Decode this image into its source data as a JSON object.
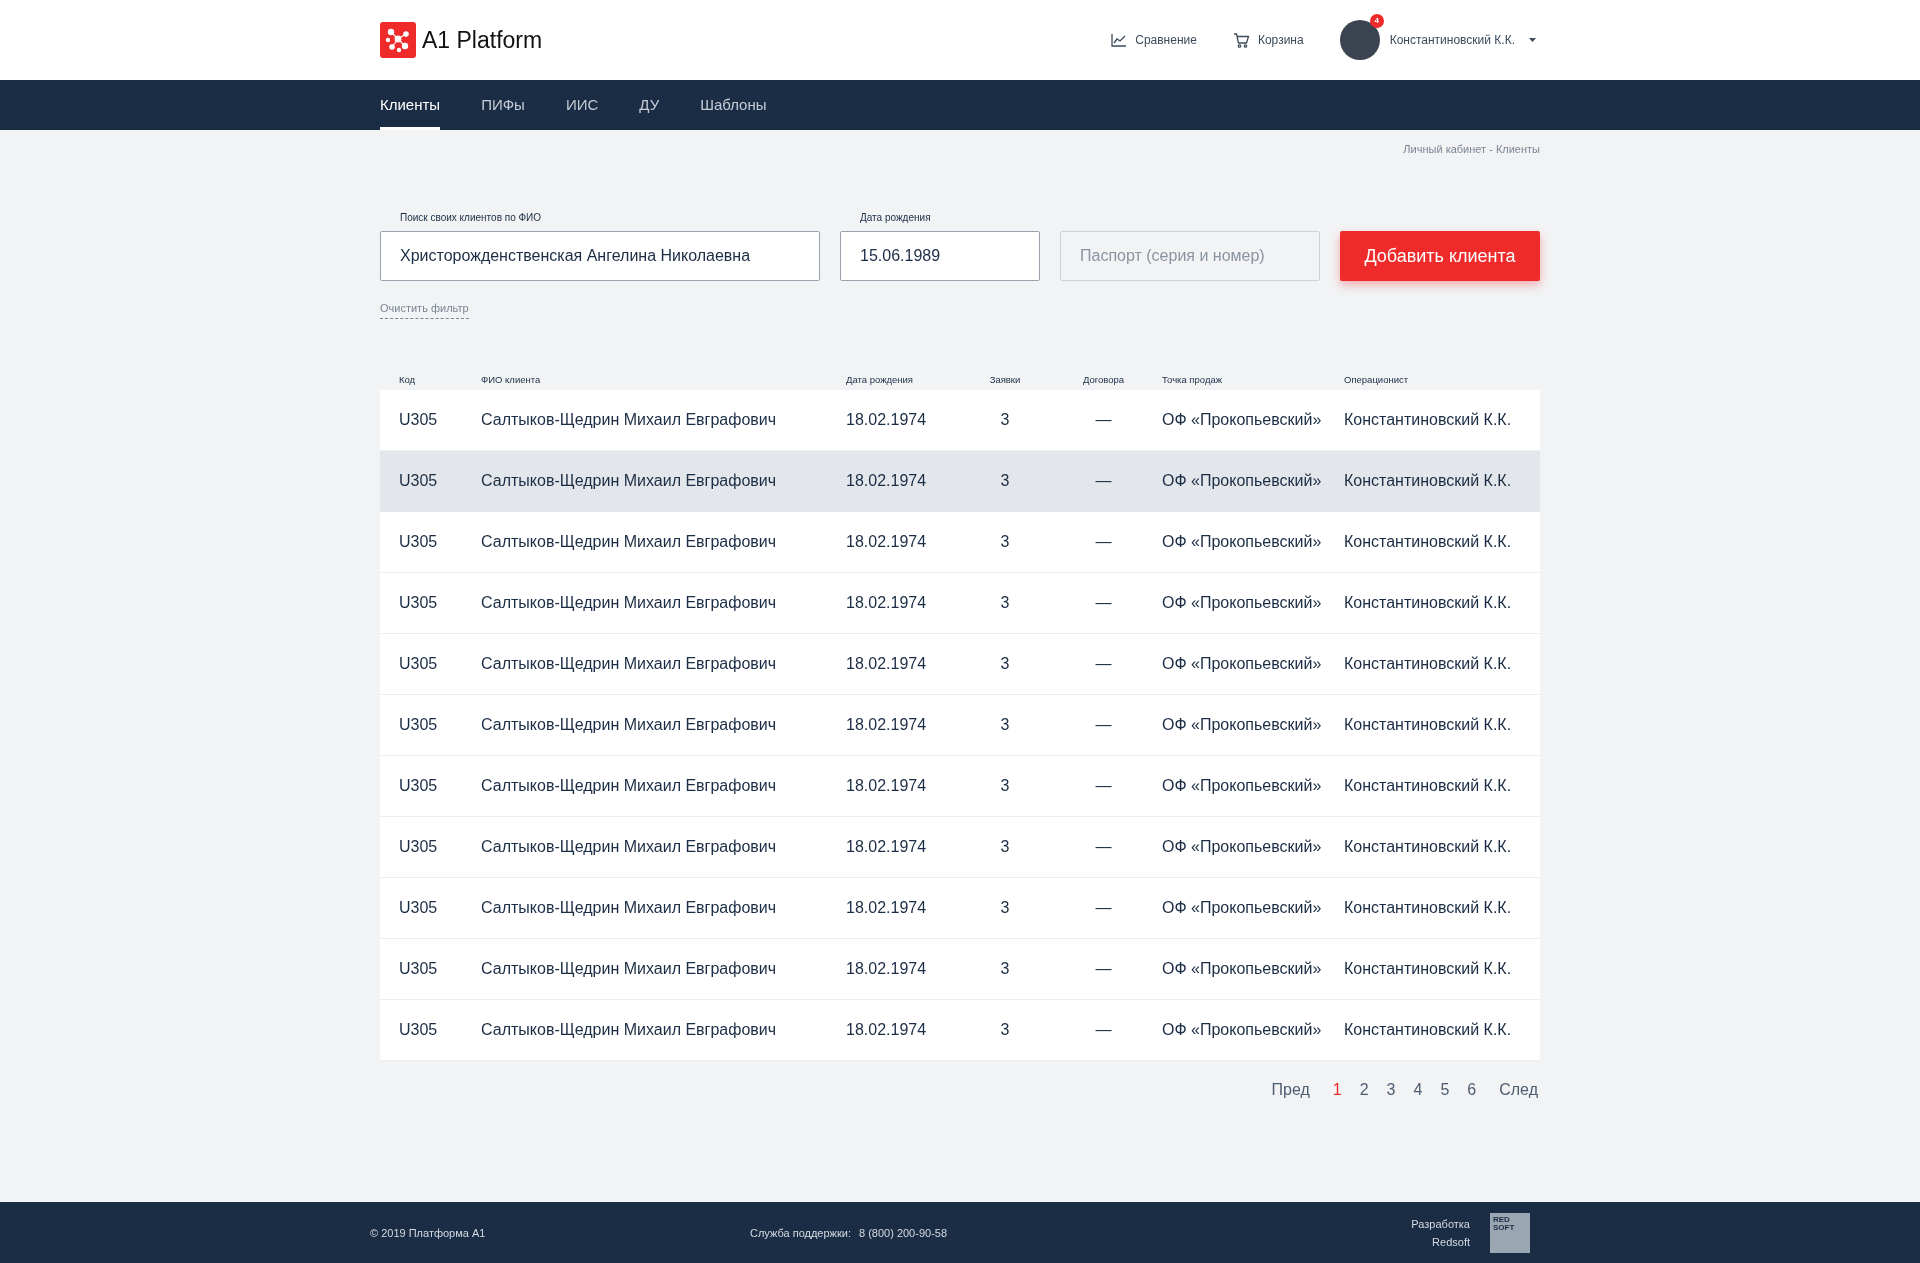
{
  "header": {
    "logo_text": "A1 Platform",
    "links": [
      {
        "kind": "chart",
        "label": "Сравнение"
      },
      {
        "kind": "cart",
        "label": "Корзина"
      }
    ],
    "user": {
      "name": "Константиновский К.К.",
      "badge": "4"
    }
  },
  "nav": [
    {
      "label": "Клиенты",
      "selected": true
    },
    {
      "label": "ПИФы",
      "selected": false
    },
    {
      "label": "ИИС",
      "selected": false
    },
    {
      "label": "ДУ",
      "selected": false
    },
    {
      "label": "Шаблоны",
      "selected": false
    }
  ],
  "breadcrumb": "Личный кабинет - Клиенты",
  "filters": {
    "name_field": {
      "label": "Поиск своих клиентов по ФИО",
      "value": "Христорожденственская Ангелина Николаевна"
    },
    "birth_field": {
      "label": "Дата рождения",
      "value": "15.06.1989"
    },
    "passport_field": {
      "placeholder": "Паспорт (серия и номер)"
    },
    "add_button": "Добавить клиента",
    "clear_link": "Очистить фильтр"
  },
  "table": {
    "columns": [
      "Код",
      "ФИО клиента",
      "Дата рождения",
      "Заявки",
      "Договора",
      "Точка продаж",
      "Операционист"
    ],
    "rows": [
      {
        "cells": [
          "U305",
          "Салтыков-Щедрин Михаил Евграфович",
          "18.02.1974",
          "3",
          "—",
          "ОФ «Прокопьевский»",
          "Константиновский К.К."
        ],
        "highlighted": false
      },
      {
        "cells": [
          "U305",
          "Салтыков-Щедрин Михаил Евграфович",
          "18.02.1974",
          "3",
          "—",
          "ОФ «Прокопьевский»",
          "Константиновский К.К."
        ],
        "highlighted": true
      },
      {
        "cells": [
          "U305",
          "Салтыков-Щедрин Михаил Евграфович",
          "18.02.1974",
          "3",
          "—",
          "ОФ «Прокопьевский»",
          "Константиновский К.К."
        ],
        "highlighted": false
      },
      {
        "cells": [
          "U305",
          "Салтыков-Щедрин Михаил Евграфович",
          "18.02.1974",
          "3",
          "—",
          "ОФ «Прокопьевский»",
          "Константиновский К.К."
        ],
        "highlighted": false
      },
      {
        "cells": [
          "U305",
          "Салтыков-Щедрин Михаил Евграфович",
          "18.02.1974",
          "3",
          "—",
          "ОФ «Прокопьевский»",
          "Константиновский К.К."
        ],
        "highlighted": false
      },
      {
        "cells": [
          "U305",
          "Салтыков-Щедрин Михаил Евграфович",
          "18.02.1974",
          "3",
          "—",
          "ОФ «Прокопьевский»",
          "Константиновский К.К."
        ],
        "highlighted": false
      },
      {
        "cells": [
          "U305",
          "Салтыков-Щедрин Михаил Евграфович",
          "18.02.1974",
          "3",
          "—",
          "ОФ «Прокопьевский»",
          "Константиновский К.К."
        ],
        "highlighted": false
      },
      {
        "cells": [
          "U305",
          "Салтыков-Щедрин Михаил Евграфович",
          "18.02.1974",
          "3",
          "—",
          "ОФ «Прокопьевский»",
          "Константиновский К.К."
        ],
        "highlighted": false
      },
      {
        "cells": [
          "U305",
          "Салтыков-Щедрин Михаил Евграфович",
          "18.02.1974",
          "3",
          "—",
          "ОФ «Прокопьевский»",
          "Константиновский К.К."
        ],
        "highlighted": false
      },
      {
        "cells": [
          "U305",
          "Салтыков-Щедрин Михаил Евграфович",
          "18.02.1974",
          "3",
          "—",
          "ОФ «Прокопьевский»",
          "Константиновский К.К."
        ],
        "highlighted": false
      },
      {
        "cells": [
          "U305",
          "Салтыков-Щедрин Михаил Евграфович",
          "18.02.1974",
          "3",
          "—",
          "ОФ «Прокопьевский»",
          "Константиновский К.К."
        ],
        "highlighted": false
      }
    ]
  },
  "pagination": {
    "prev": "Пред",
    "pages": [
      {
        "label": "1",
        "selected": true
      },
      {
        "label": "2",
        "selected": false
      },
      {
        "label": "3",
        "selected": false
      },
      {
        "label": "4",
        "selected": false
      },
      {
        "label": "5",
        "selected": false
      },
      {
        "label": "6",
        "selected": false
      }
    ],
    "next": "След"
  },
  "footer": {
    "copyright": "© 2019  Платформа А1",
    "support_label": "Служба поддержки:",
    "support_phone": "8 (800) 200-90-58",
    "developer_lines": [
      "Разработка",
      "Redsoft"
    ],
    "developer_logo_lines": [
      "RED",
      "SOFT"
    ]
  }
}
